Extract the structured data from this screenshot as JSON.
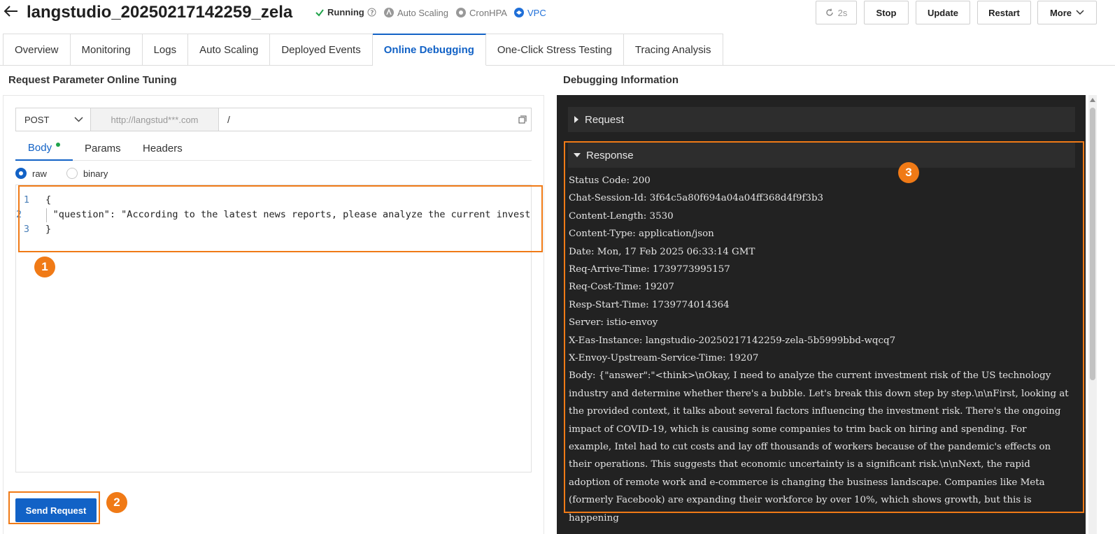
{
  "header": {
    "title": "langstudio_20250217142259_zela",
    "status_running": "Running",
    "status_autoscaling": "Auto Scaling",
    "status_cronhpa": "CronHPA",
    "status_vpc": "VPC",
    "refresh_label": "2s",
    "stop_label": "Stop",
    "update_label": "Update",
    "restart_label": "Restart",
    "more_label": "More"
  },
  "tabs": [
    {
      "label": "Overview"
    },
    {
      "label": "Monitoring"
    },
    {
      "label": "Logs"
    },
    {
      "label": "Auto Scaling"
    },
    {
      "label": "Deployed Events"
    },
    {
      "label": "Online Debugging"
    },
    {
      "label": "One-Click Stress Testing"
    },
    {
      "label": "Tracing Analysis"
    }
  ],
  "left": {
    "section_title": "Request Parameter Online Tuning",
    "method": "POST",
    "url_host": "http://langstud***.com",
    "url_path": "/",
    "subtabs": {
      "body": "Body",
      "params": "Params",
      "headers": "Headers"
    },
    "radio_raw": "raw",
    "radio_binary": "binary",
    "code_lines": [
      {
        "num": "1",
        "text": "{"
      },
      {
        "num": "2",
        "text": "    \"question\": \"According to the latest news reports, please analyze the current investment risk"
      },
      {
        "num": "3",
        "text": "}"
      }
    ],
    "send_label": "Send Request"
  },
  "right": {
    "section_title": "Debugging Information",
    "request_label": "Request",
    "response_label": "Response",
    "response_lines": [
      "Status Code: 200",
      "Chat-Session-Id: 3f64c5a80f694a04a04ff368d4f9f3b3",
      "Content-Length: 3530",
      "Content-Type: application/json",
      "Date: Mon, 17 Feb 2025 06:33:14 GMT",
      "Req-Arrive-Time: 1739773995157",
      "Req-Cost-Time: 19207",
      "Resp-Start-Time: 1739774014364",
      "Server: istio-envoy",
      "X-Eas-Instance: langstudio-20250217142259-zela-5b5999bbd-wqcq7",
      "X-Envoy-Upstream-Service-Time: 19207"
    ],
    "body_text": "Body: {\"answer\":\"<think>\\nOkay, I need to analyze the current investment risk of the US technology industry and determine whether there's a bubble. Let's break this down step by step.\\n\\nFirst, looking at the provided context, it talks about several factors influencing the investment risk. There's the ongoing impact of COVID-19, which is causing some companies to trim back on hiring and spending. For example, Intel had to cut costs and lay off thousands of workers because of the pandemic's effects on their operations. This suggests that economic uncertainty is a significant risk.\\n\\nNext, the rapid adoption of remote work and e-commerce is changing the business landscape. Companies like Meta (formerly Facebook) are expanding their workforce by over 10%, which shows growth, but this is happening"
  },
  "callouts": {
    "one": "1",
    "two": "2",
    "three": "3"
  },
  "colors": {
    "accent": "#1262c6",
    "callout": "#f07a16",
    "running": "#1fa34a",
    "dark_panel": "#222222"
  }
}
